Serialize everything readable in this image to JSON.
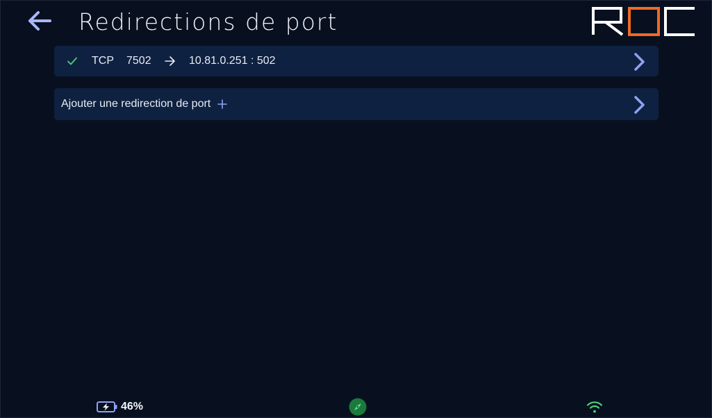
{
  "header": {
    "title": "Redirections de port",
    "back_icon": "arrow-left-icon",
    "logo_text": "ROC",
    "colors": {
      "logo_white": "#ffffff",
      "logo_orange": "#ee6a24",
      "accent": "#8ea2f2"
    }
  },
  "rules": [
    {
      "status_icon": "check-icon",
      "protocol": "TCP",
      "port": "7502",
      "direction_icon": "arrow-right-icon",
      "target": "10.81.0.251 : 502"
    }
  ],
  "add_rule": {
    "label": "Ajouter une redirection de port",
    "icon": "plus-icon"
  },
  "status_bar": {
    "battery_percent": "46%",
    "battery_level": 0.46,
    "battery_icon": "battery-charging-icon",
    "location_icon": "compass-icon",
    "network_icon": "wifi-icon",
    "colors": {
      "ok_green": "#4cd07a",
      "compass_bg": "#1a7a3c"
    }
  }
}
